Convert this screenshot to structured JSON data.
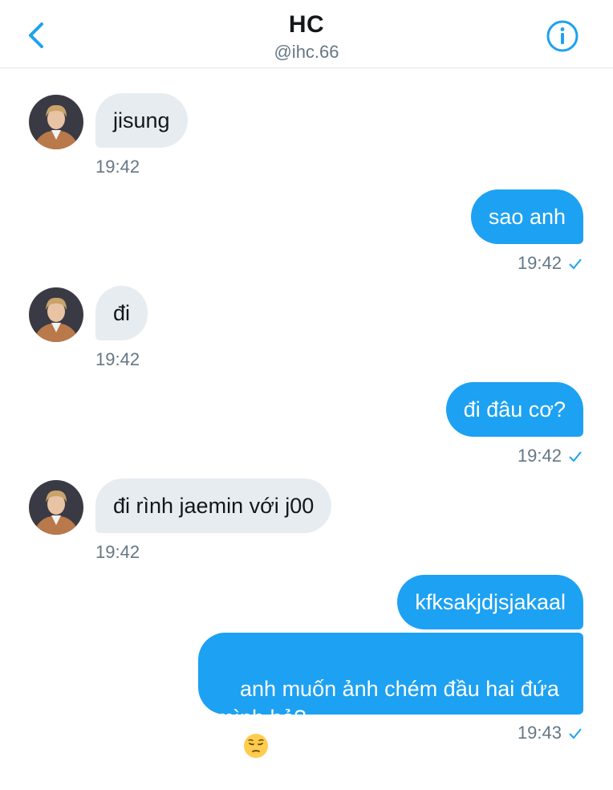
{
  "header": {
    "title": "HC",
    "handle": "@ihc.66",
    "back_icon": "chevron-left-icon",
    "info_icon": "info-icon",
    "accent": "#1da1f2"
  },
  "messages": [
    {
      "direction": "in",
      "text": "jisung",
      "time": "19:42"
    },
    {
      "direction": "out",
      "text": "sao anh",
      "time": "19:42",
      "read": true
    },
    {
      "direction": "in",
      "text": "đi",
      "time": "19:42"
    },
    {
      "direction": "out",
      "text": "đi đâu cơ?",
      "time": "19:42",
      "read": true
    },
    {
      "direction": "in",
      "text": "đi rình jaemin với j00",
      "time": "19:42"
    },
    {
      "direction": "out",
      "text": "kfksakjdjsjakaal"
    },
    {
      "direction": "out",
      "text_line1": "anh muốn ảnh chém đầu hai đứa",
      "text_line2": "mình hả?",
      "emoji": "pensive-face-emoji",
      "time": "19:43",
      "read": true
    }
  ],
  "colors": {
    "incoming_bubble": "#e6ecf0",
    "outgoing_bubble": "#1da1f2",
    "timestamp": "#657786"
  }
}
